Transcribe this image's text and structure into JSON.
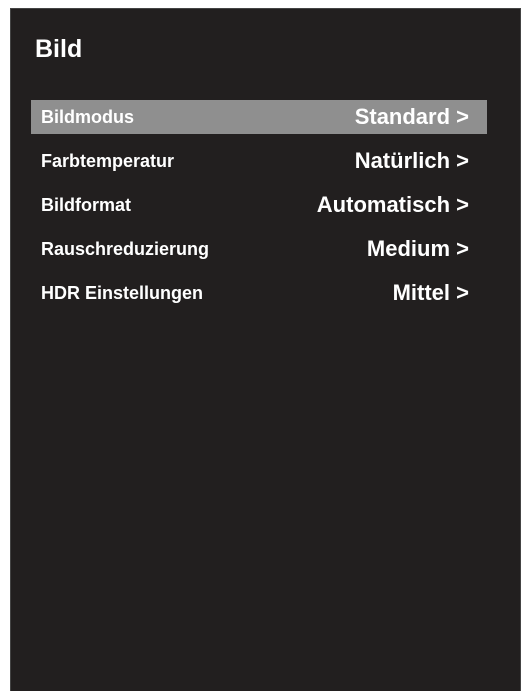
{
  "screen": {
    "title": "Bild"
  },
  "menu": {
    "items": [
      {
        "label": "Bildmodus",
        "value": "Standard >",
        "selected": true
      },
      {
        "label": "Farbtemperatur",
        "value": "Natürlich >",
        "selected": false
      },
      {
        "label": "Bildformat",
        "value": "Automatisch >",
        "selected": false
      },
      {
        "label": "Rauschreduzierung",
        "value": "Medium >",
        "selected": false
      },
      {
        "label": "HDR Einstellungen",
        "value": "Mittel >",
        "selected": false
      }
    ]
  },
  "colors": {
    "panel_background": "#221f1f",
    "selected_background": "#8f8f8f",
    "text": "#ffffff"
  }
}
